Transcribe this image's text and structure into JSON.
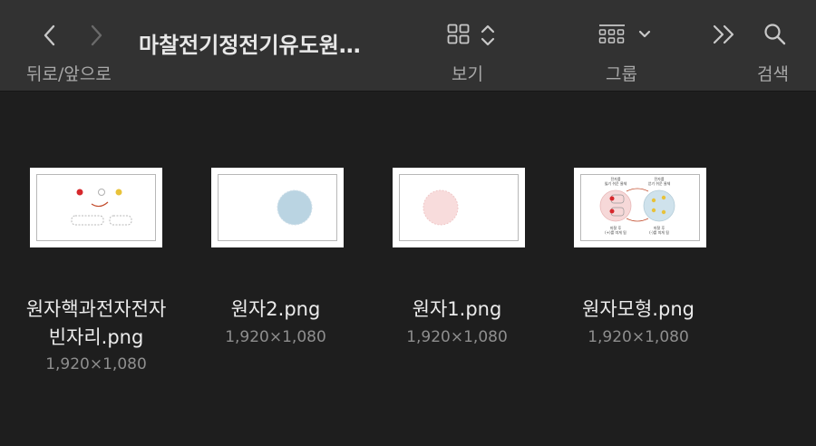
{
  "toolbar": {
    "back_label": "뒤로/앞으로",
    "title": "마찰전기정전기유도원…",
    "view_label": "보기",
    "group_label": "그룹",
    "search_label": "검색"
  },
  "files": [
    {
      "name_line1": "원자핵과전자전자",
      "name_line2": "빈자리.png",
      "size": "1,920×1,080"
    },
    {
      "name_line1": "원자2.png",
      "name_line2": "",
      "size": "1,920×1,080"
    },
    {
      "name_line1": "원자1.png",
      "name_line2": "",
      "size": "1,920×1,080"
    },
    {
      "name_line1": "원자모형.png",
      "name_line2": "",
      "size": "1,920×1,080"
    }
  ],
  "thumb4_text": {
    "t1a": "전자를",
    "t1b": "잃기 쉬운 물체",
    "t2a": "전자를",
    "t2b": "얻기 쉬운 물체",
    "b1a": "마찰 후",
    "b1b": "(+)를 띠게 됨",
    "b2a": "마찰 후",
    "b2b": "(-)를 띠게 됨"
  },
  "colors": {
    "toolbar_bg": "#323232",
    "window_bg": "#1e1e1e",
    "icon_color": "#c8c8c8",
    "disabled_icon": "#6a6a6a"
  }
}
